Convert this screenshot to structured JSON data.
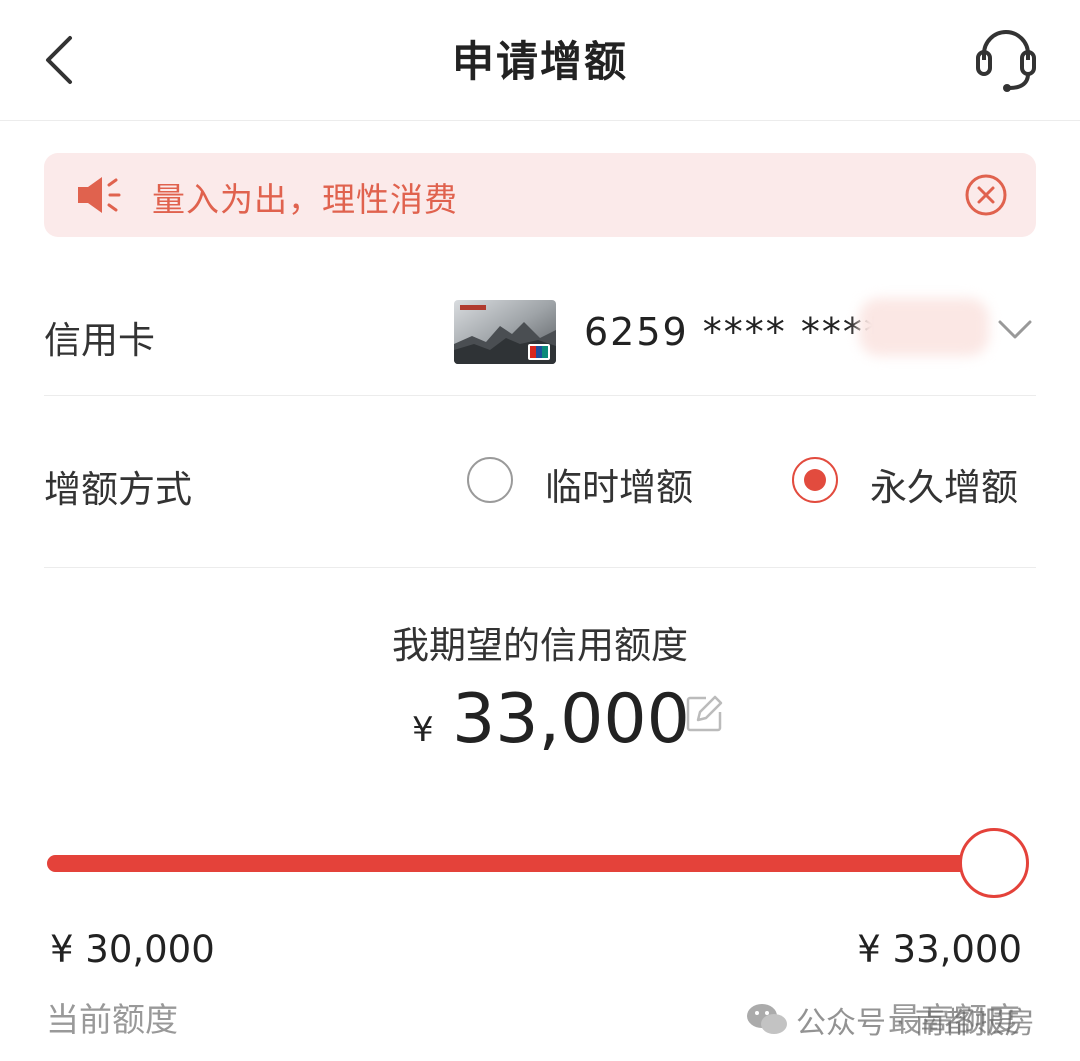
{
  "header": {
    "title": "申请增额",
    "back_icon": "chevron-left-icon",
    "service_icon": "headset-icon"
  },
  "notice": {
    "text": "量入为出，理性消费",
    "icon": "speaker-icon",
    "close_icon": "close-circle-icon",
    "color": "#e0624e",
    "background": "#fbeaea"
  },
  "card": {
    "label": "信用卡",
    "number": "6259 **** ****",
    "dropdown_icon": "chevron-down-icon"
  },
  "mode": {
    "label": "增额方式",
    "options": [
      {
        "label": "临时增额",
        "selected": false
      },
      {
        "label": "永久增额",
        "selected": true
      }
    ]
  },
  "desired": {
    "label": "我期望的信用额度",
    "currency": "¥",
    "amount": "33,000",
    "edit_icon": "edit-icon"
  },
  "slider": {
    "min_value": "¥ 30,000",
    "min_label": "当前额度",
    "max_value": "¥ 33,000",
    "max_label": "最高额度",
    "fill_fraction": 1.0,
    "accent": "#e4423a"
  },
  "watermark": {
    "text": "公众号 · 南都报房"
  }
}
